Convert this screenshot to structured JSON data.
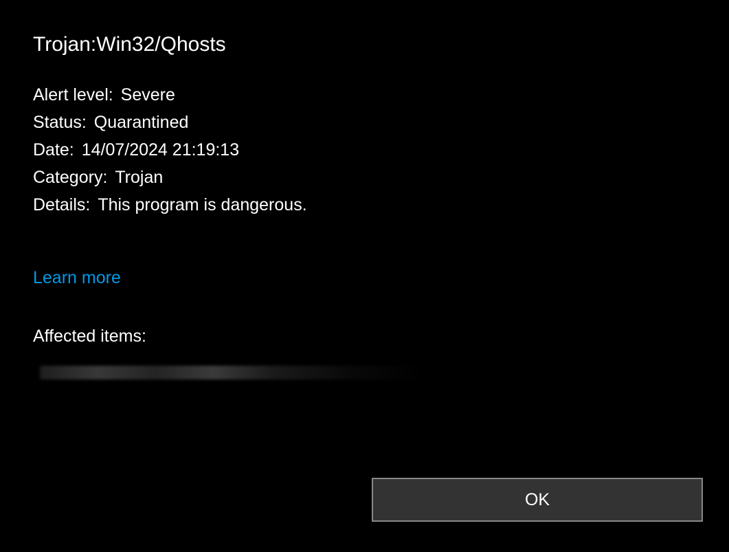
{
  "threat_name": "Trojan:Win32/Qhosts",
  "fields": {
    "alert_level": {
      "label": "Alert level:",
      "value": "Severe"
    },
    "status": {
      "label": "Status:",
      "value": "Quarantined"
    },
    "date": {
      "label": "Date:",
      "value": "14/07/2024 21:19:13"
    },
    "category": {
      "label": "Category:",
      "value": "Trojan"
    },
    "details": {
      "label": "Details:",
      "value": "This program is dangerous."
    }
  },
  "learn_more_label": "Learn more",
  "affected_items_label": "Affected items:",
  "ok_button_label": "OK"
}
